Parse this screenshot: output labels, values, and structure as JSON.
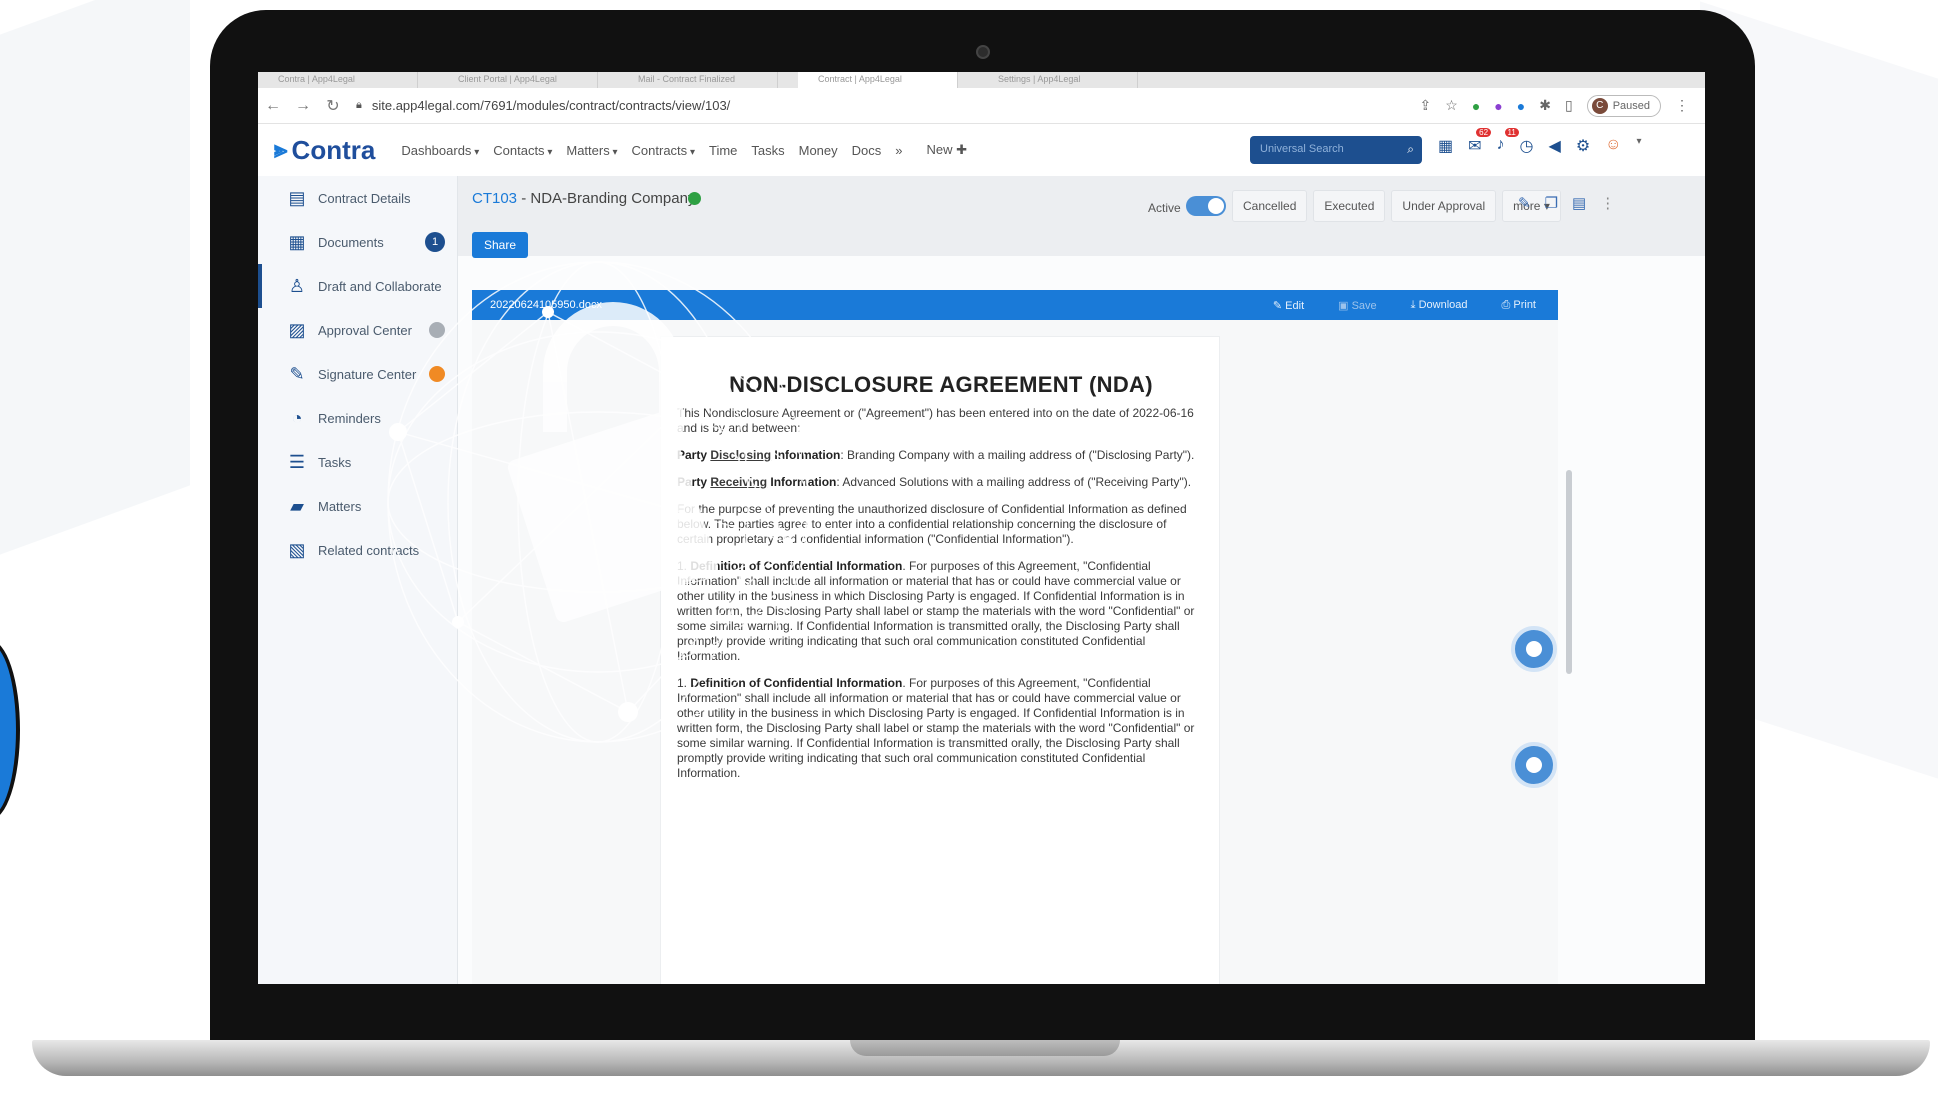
{
  "browser": {
    "tabs": [
      "Contra | App4Legal",
      "Client Portal | App4Legal",
      "Mail - Contract Finalized",
      "Contract | App4Legal",
      "Settings | App4Legal"
    ],
    "url": "site.app4legal.com/7691/modules/contract/contracts/view/103/",
    "profile_initial": "C",
    "profile_status": "Paused"
  },
  "header": {
    "logo": "Contra",
    "menu": [
      {
        "label": "Dashboards",
        "caret": true
      },
      {
        "label": "Contacts",
        "caret": true
      },
      {
        "label": "Matters",
        "caret": true
      },
      {
        "label": "Contracts",
        "caret": true
      },
      {
        "label": "Time",
        "caret": false
      },
      {
        "label": "Tasks",
        "caret": false
      },
      {
        "label": "Money",
        "caret": false
      },
      {
        "label": "Docs",
        "caret": false
      }
    ],
    "more_glyph": "»",
    "new_label": "New ✚",
    "search_placeholder": "Universal Search",
    "notification_badges": [
      "62",
      "11"
    ]
  },
  "sidebar": {
    "items": [
      {
        "label": "Contract Details",
        "icon": "▤",
        "badge": "",
        "badge_color": ""
      },
      {
        "label": "Documents",
        "icon": "▦",
        "badge": "1",
        "badge_color": "#1d4f8f"
      },
      {
        "label": "Draft and Collaborate",
        "icon": "♙",
        "badge": "",
        "badge_color": ""
      },
      {
        "label": "Approval Center",
        "icon": "▨",
        "badge": "",
        "badge_color": "#a8aeb5"
      },
      {
        "label": "Signature Center",
        "icon": "✎",
        "badge": "",
        "badge_color": "#f08a24"
      },
      {
        "label": "Reminders",
        "icon": "◔",
        "badge": "",
        "badge_color": ""
      },
      {
        "label": "Tasks",
        "icon": "☰",
        "badge": "",
        "badge_color": ""
      },
      {
        "label": "Matters",
        "icon": "▰",
        "badge": "",
        "badge_color": ""
      },
      {
        "label": "Related contracts",
        "icon": "▧",
        "badge": "",
        "badge_color": ""
      }
    ]
  },
  "contract": {
    "code": "CT103",
    "title": " - NDA-Branding Company",
    "share_label": "Share",
    "active_label": "Active",
    "status_buttons": [
      "Cancelled",
      "Executed",
      "Under Approval",
      "more ▾"
    ]
  },
  "docbar": {
    "filename": "20220624105950.docx",
    "edit": "✎ Edit",
    "save": "▣ Save",
    "download": "⤓ Download",
    "print": "⎙ Print"
  },
  "document": {
    "heading": "NON-DISCLOSURE AGREEMENT (NDA)",
    "intro": "This Nondisclosure Agreement or (\"Agreement\") has been entered into on the date of 2022-06-16 and is by and between:",
    "party1_prefix": "Party ",
    "party1_underline": "Disclosing",
    "party1_bold_rest": " Information",
    "party1_text": ": Branding Company with a mailing address of  (\"Disclosing Party\").",
    "party2_prefix": "Party ",
    "party2_underline": "Receiving",
    "party2_bold_rest": " Information",
    "party2_text": ": Advanced Solutions with a mailing address of  (\"Receiving Party\").",
    "purpose": "For the purpose of preventing the unauthorized disclosure of Confidential Information as defined below. The parties agree to enter into a confidential relationship concerning the disclosure of certain proprietary and confidential information (\"Confidential Information\").",
    "clause_number": "1. ",
    "clause_title": "Definition of Confidential Information",
    "clause_text": ". For purposes of this Agreement, \"Confidential Information\" shall include all information or material that has or could have commercial value or other utility in the business in which Disclosing Party is engaged. If Confidential Information is in written form, the Disclosing Party shall label or stamp the materials with the word \"Confidential\" or some similar warning. If Confidential Information is transmitted orally, the Disclosing Party shall promptly provide writing indicating that such oral communication constituted Confidential Information."
  },
  "colors": {
    "brand": "#1d4f8f",
    "accent": "#1a7ad8",
    "status_active": "#2ea043"
  }
}
